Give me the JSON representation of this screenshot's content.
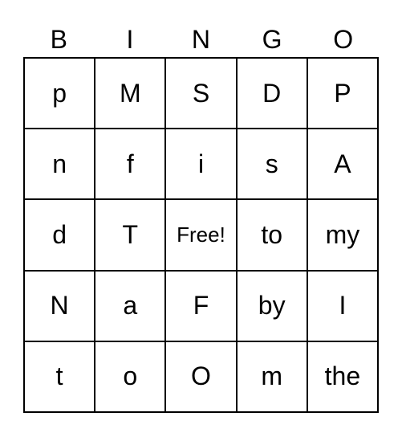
{
  "header": [
    "B",
    "I",
    "N",
    "G",
    "O"
  ],
  "rows": [
    [
      "p",
      "M",
      "S",
      "D",
      "P"
    ],
    [
      "n",
      "f",
      "i",
      "s",
      "A"
    ],
    [
      "d",
      "T",
      "Free!",
      "to",
      "my"
    ],
    [
      "N",
      "a",
      "F",
      "by",
      "I"
    ],
    [
      "t",
      "o",
      "O",
      "m",
      "the"
    ]
  ]
}
